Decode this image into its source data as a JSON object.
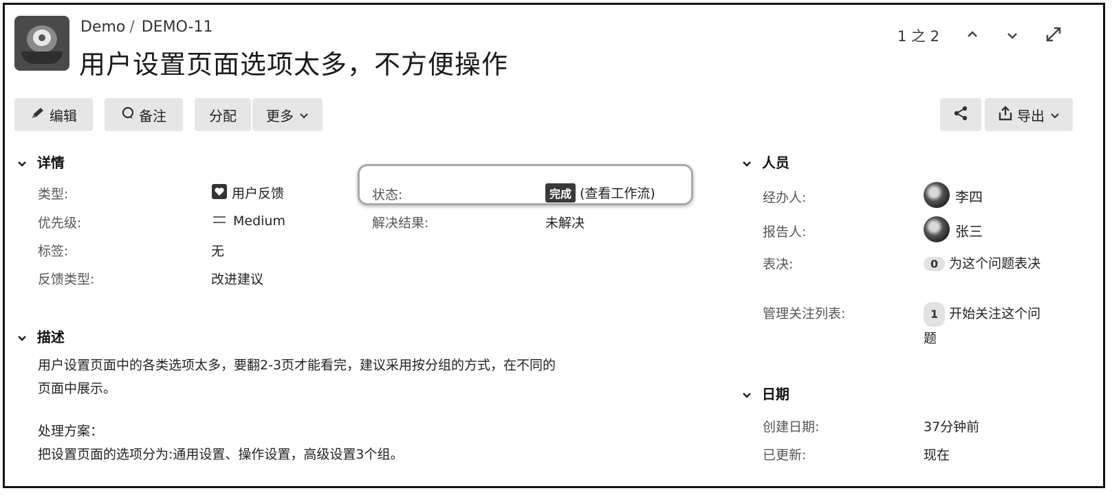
{
  "header": {
    "project": "Demo",
    "separator": "/",
    "issue_key": "DEMO-11",
    "title": "用户设置页面选项太多，不方便操作"
  },
  "pager": {
    "position": "1 之 2",
    "up_icon": "chevron-up-icon",
    "down_icon": "chevron-down-icon",
    "expand_icon": "expand-icon"
  },
  "toolbar": {
    "edit": "编辑",
    "comment": "备注",
    "assign": "分配",
    "more": "更多",
    "export": "导出"
  },
  "details": {
    "heading": "详情",
    "type_label": "类型:",
    "type_value": "用户反馈",
    "priority_label": "优先级:",
    "priority_value": "Medium",
    "labels_label": "标签:",
    "labels_value": "无",
    "feedback_type_label": "反馈类型:",
    "feedback_type_value": "改进建议",
    "status_label": "状态:",
    "status_value": "完成",
    "workflow_link": "(查看工作流)",
    "resolution_label": "解决结果:",
    "resolution_value": "未解决"
  },
  "description": {
    "heading": "描述",
    "line1": "用户设置页面中的各类选项太多，要翻2-3页才能看完，建议采用按分组的方式，在不同的",
    "line2": "页面中展示。",
    "line3": "处理方案：",
    "line4": "把设置页面的选项分为:通用设置、操作设置，高级设置3个组。"
  },
  "people": {
    "heading": "人员",
    "assignee_label": "经办人:",
    "assignee": "李四",
    "reporter_label": "报告人:",
    "reporter": "张三",
    "votes_label": "表决:",
    "votes_count": "0",
    "votes_link": "为这个问题表决",
    "watchers_label": "管理关注列表:",
    "watchers_count": "1",
    "watch_link_1": "开始关注这个问",
    "watch_link_2": "题"
  },
  "dates": {
    "heading": "日期",
    "created_label": "创建日期:",
    "created_value": "37分钟前",
    "updated_label": "已更新:",
    "updated_value": "现在"
  }
}
